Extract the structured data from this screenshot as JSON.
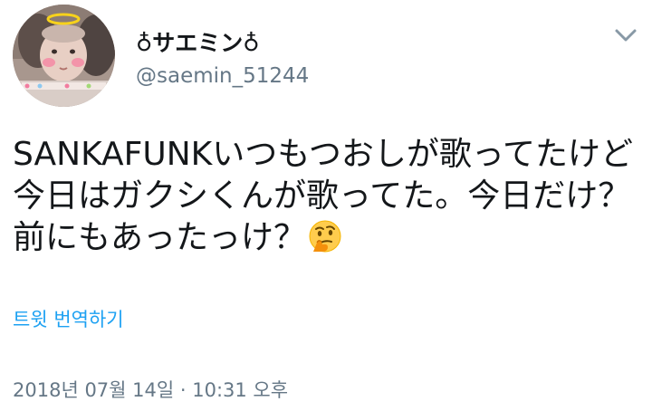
{
  "user": {
    "display_name": "♁サエミン♁",
    "handle": "@saemin_51244"
  },
  "tweet": {
    "lines": [
      "SANKAFUNKいつもつおしが歌ってたけど",
      "今日はガクシくんが歌ってた。今日だけ？",
      "前にもあったっけ？"
    ],
    "emoji": "thinking-face",
    "translate_label": "트윗 번역하기",
    "timestamp": "2018년 07월 14일 · 10:31 오후"
  },
  "colors": {
    "text": "#14171a",
    "secondary": "#657786",
    "link": "#1da1f2"
  },
  "icons": [
    "avatar-photo",
    "chevron-down-icon",
    "thinking-face-emoji"
  ]
}
